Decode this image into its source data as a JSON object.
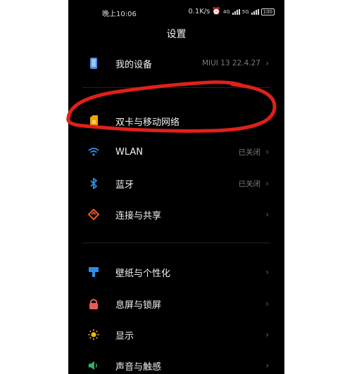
{
  "status_bar": {
    "time": "晚上10:06",
    "net_speed": "0.1K/s",
    "net_type": "4G",
    "net_type2": "5G",
    "battery": "100"
  },
  "page": {
    "title": "设置"
  },
  "rows": [
    {
      "label": "我的设备",
      "value": "MIUI 13 22.4.27",
      "icon": "phone-icon",
      "color": "#4a90e2"
    },
    {
      "label": "双卡与移动网络",
      "value": "",
      "icon": "sim-card-icon",
      "color": "#f0a500"
    },
    {
      "label": "WLAN",
      "value": "已关闭",
      "icon": "wifi-icon",
      "color": "#2f8de4"
    },
    {
      "label": "蓝牙",
      "value": "已关闭",
      "icon": "bluetooth-icon",
      "color": "#2f8de4"
    },
    {
      "label": "连接与共享",
      "value": "",
      "icon": "share-icon",
      "color": "#f05a28"
    },
    {
      "label": "壁纸与个性化",
      "value": "",
      "icon": "wallpaper-icon",
      "color": "#2f8de4"
    },
    {
      "label": "息屏与锁屏",
      "value": "",
      "icon": "lock-icon",
      "color": "#e85a5a"
    },
    {
      "label": "显示",
      "value": "",
      "icon": "sun-icon",
      "color": "#f3b512"
    },
    {
      "label": "声音与触感",
      "value": "",
      "icon": "speaker-icon",
      "color": "#34b36a"
    }
  ],
  "annotation": {
    "color": "#e0201a"
  }
}
